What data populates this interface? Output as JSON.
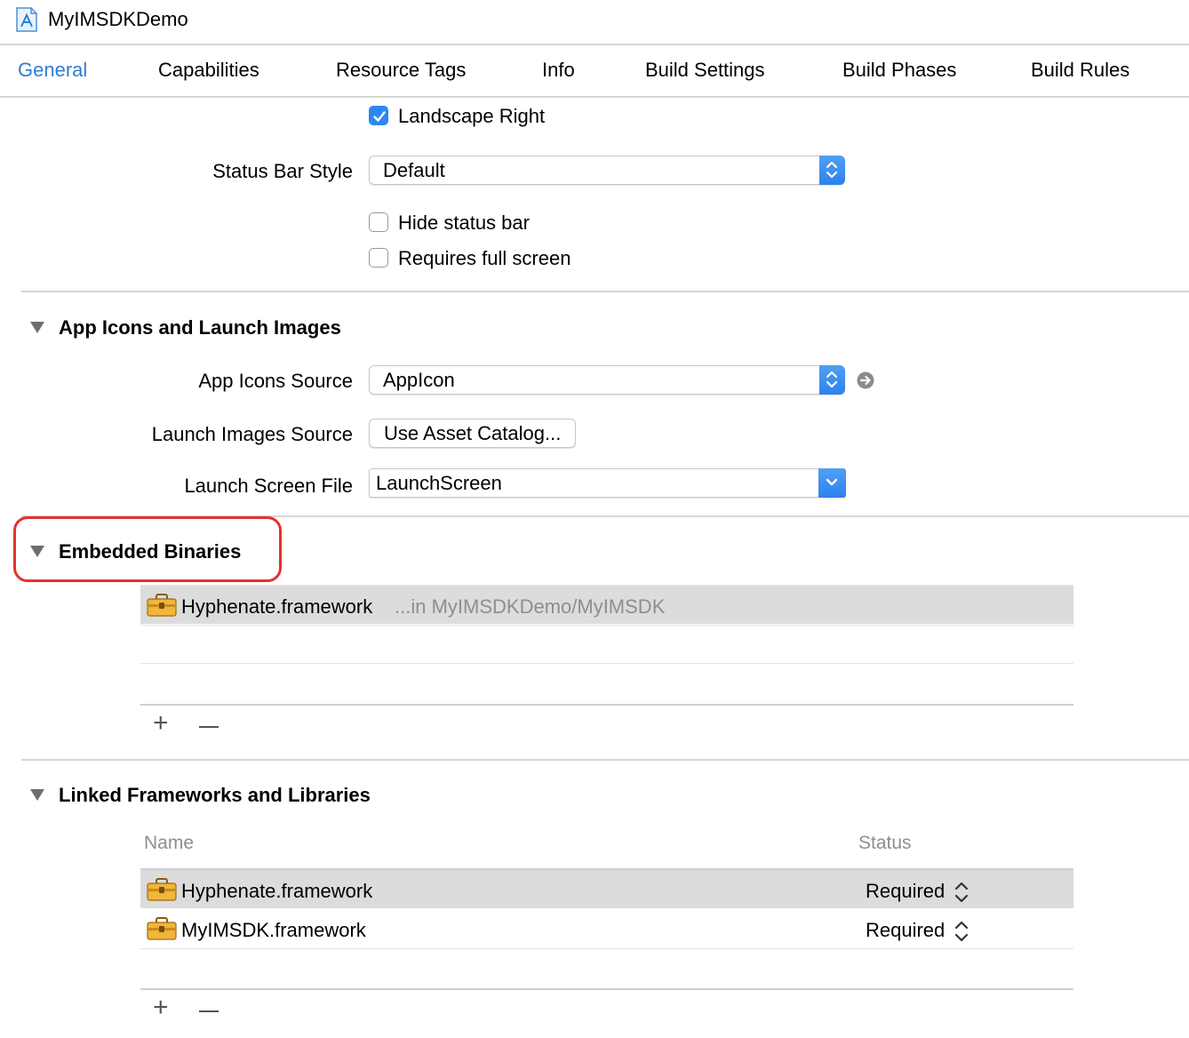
{
  "project": {
    "title": "MyIMSDKDemo",
    "icon": "xcode-project-icon"
  },
  "tabs": [
    {
      "label": "General",
      "active": true
    },
    {
      "label": "Capabilities"
    },
    {
      "label": "Resource Tags"
    },
    {
      "label": "Info"
    },
    {
      "label": "Build Settings"
    },
    {
      "label": "Build Phases"
    },
    {
      "label": "Build Rules"
    }
  ],
  "orientation": {
    "landscape_right": {
      "label": "Landscape Right",
      "checked": true
    }
  },
  "status_bar": {
    "style_label": "Status Bar Style",
    "style_value": "Default",
    "hide_label": "Hide status bar",
    "hide_checked": false,
    "fullscreen_label": "Requires full screen",
    "fullscreen_checked": false
  },
  "app_icons": {
    "title": "App Icons and Launch Images",
    "icons_source_label": "App Icons Source",
    "icons_source_value": "AppIcon",
    "launch_images_label": "Launch Images Source",
    "launch_images_button": "Use Asset Catalog...",
    "launch_screen_label": "Launch Screen File",
    "launch_screen_value": "LaunchScreen"
  },
  "embedded": {
    "title": "Embedded Binaries",
    "items": [
      {
        "name": "Hyphenate.framework",
        "path": "...in MyIMSDKDemo/MyIMSDK",
        "icon": "toolbox-icon"
      }
    ]
  },
  "linked": {
    "title": "Linked Frameworks and Libraries",
    "col_name": "Name",
    "col_status": "Status",
    "items": [
      {
        "name": "Hyphenate.framework",
        "status": "Required",
        "icon": "toolbox-icon"
      },
      {
        "name": "MyIMSDK.framework",
        "status": "Required",
        "icon": "toolbox-icon"
      }
    ]
  },
  "colors": {
    "accent": "#2a7fd7",
    "checkbox": "#2e87f1",
    "annotation": "#e5312e",
    "selection": "#dcdcdc"
  }
}
